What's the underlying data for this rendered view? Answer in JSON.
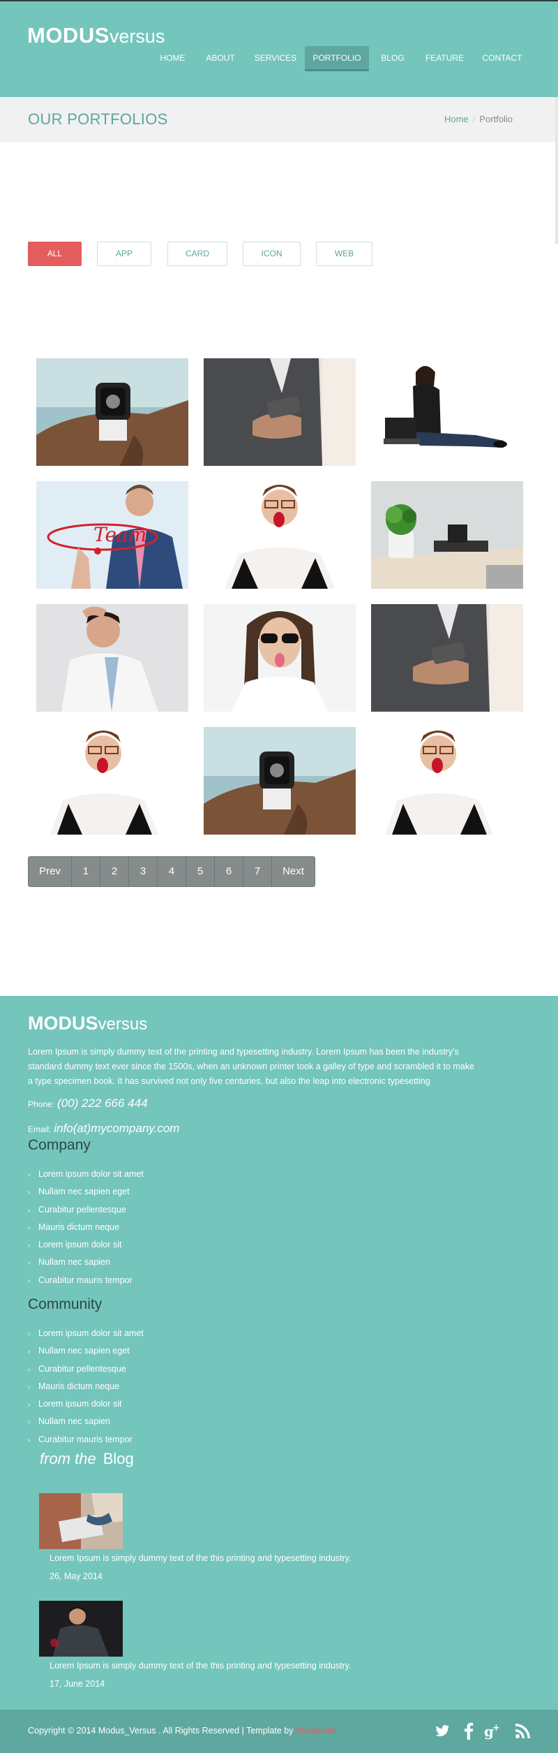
{
  "brand": {
    "bold": "MODUS",
    "light": "versus"
  },
  "nav": {
    "items": [
      {
        "label": "HOME"
      },
      {
        "label": "ABOUT"
      },
      {
        "label": "SERVICES"
      },
      {
        "label": "PORTFOLIO",
        "active": true
      },
      {
        "label": "BLOG"
      },
      {
        "label": "FEATURE"
      },
      {
        "label": "CONTACT"
      }
    ]
  },
  "page": {
    "title": "OUR PORTFOLIOS",
    "breadcrumb": {
      "home": "Home",
      "current": "Portfolio"
    }
  },
  "filters": [
    {
      "label": "ALL",
      "active": true
    },
    {
      "label": "APP"
    },
    {
      "label": "CARD"
    },
    {
      "label": "ICON"
    },
    {
      "label": "WEB"
    }
  ],
  "gallery": {
    "items": [
      {
        "subject": "smartwatch on wrist"
      },
      {
        "subject": "businessman holding phone"
      },
      {
        "subject": "woman with laptop on floor"
      },
      {
        "subject": "man writing team"
      },
      {
        "subject": "man yawning with glasses"
      },
      {
        "subject": "desk with plant and laptop"
      },
      {
        "subject": "stressed businessman"
      },
      {
        "subject": "man with sunglasses tongue out"
      },
      {
        "subject": "businessman holding phone"
      },
      {
        "subject": "man yawning with glasses"
      },
      {
        "subject": "smartwatch on wrist"
      },
      {
        "subject": "man yawning with glasses"
      }
    ]
  },
  "pagination": {
    "prev": "Prev",
    "next": "Next",
    "pages": [
      "1",
      "2",
      "3",
      "4",
      "5",
      "6",
      "7"
    ]
  },
  "footer": {
    "about": "Lorem Ipsum is simply dummy text of the printing and typesetting industry. Lorem Ipsum has been the industry's standard dummy text ever since the 1500s, when an unknown printer took a galley of type and scrambled it to make a type specimen book. It has survived not only five centuries, but also the leap into electronic typesetting",
    "phone_label": "Phone:",
    "phone": "(00) 222 666 444",
    "email_label": "Email:",
    "email": "info(at)mycompany.com",
    "company": {
      "heading": "Company",
      "links": [
        "Lorem ipsum dolor sit amet",
        "Nullam nec sapien eget",
        "Curabitur pellentesque",
        "Mauris dictum neque",
        "Lorem ipsum dolor sit",
        "Nullam nec sapien",
        "Curabitur mauris tempor"
      ]
    },
    "community": {
      "heading": "Community",
      "links": [
        "Lorem ipsum dolor sit amet",
        "Nullam nec sapien eget",
        "Curabitur pellentesque",
        "Mauris dictum neque",
        "Lorem ipsum dolor sit",
        "Nullam nec sapien",
        "Curabitur mauris tempor"
      ]
    },
    "blog": {
      "heading_em": "from the",
      "heading": "Blog",
      "posts": [
        {
          "text": "Lorem Ipsum is simply dummy text of the this printing and typesetting industry.",
          "date": "26, May 2014"
        },
        {
          "text": "Lorem Ipsum is simply dummy text of the this printing and typesetting industry.",
          "date": "17, June 2014"
        }
      ]
    },
    "copyright": "Copyright © 2014 Modus_Versus . All Rights Reserved | Template by",
    "copyright_brand": "W3layouts",
    "social": [
      "twitter-icon",
      "facebook-icon",
      "google-plus-icon",
      "rss-icon"
    ]
  },
  "colors": {
    "teal": "#74c5bc",
    "teal_dark": "#5fa8a0",
    "accent_red": "#e35d5e",
    "pager_gray": "#858c8b"
  }
}
